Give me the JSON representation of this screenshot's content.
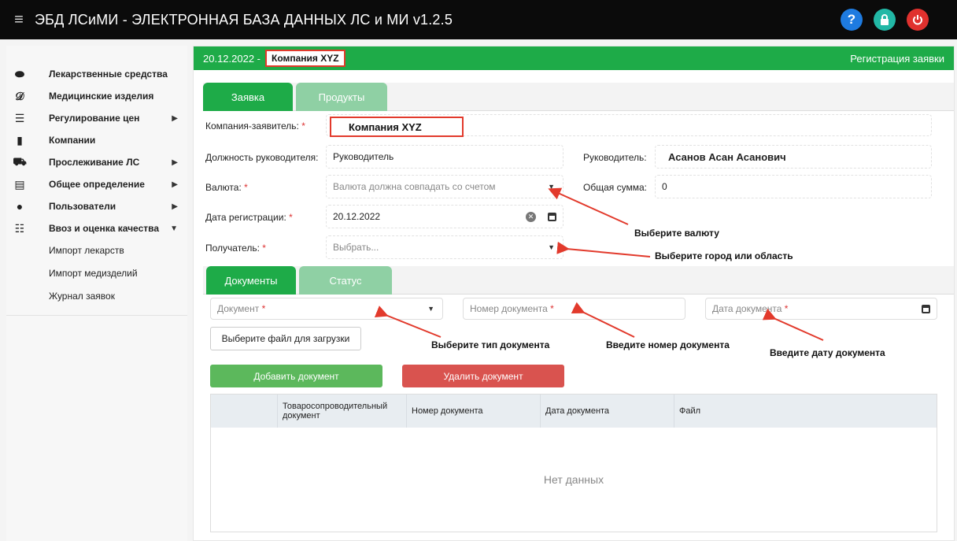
{
  "app": {
    "menu_icon": "hamburger-icon",
    "title": "ЭБД ЛСиМИ - ЭЛЕКТРОННАЯ БАЗА ДАННЫХ ЛС и МИ v1.2.5",
    "icons": [
      "help-icon",
      "lock-icon",
      "power-icon"
    ]
  },
  "sidebar": {
    "items": [
      {
        "label": "Лекарственные средства",
        "icon": "pills-icon",
        "has_arrow": false
      },
      {
        "label": "Медицинские изделия",
        "icon": "hearing-icon",
        "has_arrow": false
      },
      {
        "label": "Регулирование цен",
        "icon": "list-check-icon",
        "has_arrow": true
      },
      {
        "label": "Компании",
        "icon": "briefcase-icon",
        "has_arrow": false
      },
      {
        "label": "Прослеживание ЛС",
        "icon": "ambulance-icon",
        "has_arrow": true
      },
      {
        "label": "Общее определение",
        "icon": "list-box-icon",
        "has_arrow": true
      },
      {
        "label": "Пользователи",
        "icon": "user-icon",
        "has_arrow": true
      },
      {
        "label": "Ввоз и оценка качества",
        "icon": "indent-icon",
        "has_arrow": true
      }
    ],
    "subitems": [
      "Импорт лекарств",
      "Импорт медизделий",
      "Журнал заявок"
    ]
  },
  "header": {
    "date": "20.12.2022 -",
    "company": "Компания XYZ",
    "right": "Регистрация заявки"
  },
  "tabs1": [
    "Заявка",
    "Продукты"
  ],
  "form": {
    "company_label": "Компания-заявитель:",
    "company_value": "Компания XYZ",
    "position_label": "Должность руководителя:",
    "position_value": "Руководитель",
    "head_label": "Руководитель:",
    "head_value": "Асанов Асан Асанович",
    "currency_label": "Валюта:",
    "currency_placeholder": "Валюта должна совпадать со счетом",
    "total_label": "Общая сумма:",
    "total_value": "0",
    "regdate_label": "Дата регистрации:",
    "regdate_value": "20.12.2022",
    "recipient_label": "Получатель:",
    "recipient_placeholder": "Выбрать...",
    "required_mark": "*"
  },
  "tabs2": [
    "Документы",
    "Статус"
  ],
  "docs": {
    "doc_type_placeholder": "Документ",
    "doc_number_placeholder": "Номер документа",
    "doc_date_placeholder": "Дата документа",
    "file_button": "Выберите файл для загрузки",
    "add_button": "Добавить документ",
    "delete_button": "Удалить документ",
    "columns": [
      "",
      "Товаросопроводительный документ",
      "Номер документа",
      "Дата документа",
      "Файл"
    ],
    "empty_text": "Нет данных"
  },
  "annotations": {
    "currency": "Выберите валюту",
    "recipient": "Выберите город или область",
    "doc_type": "Выберите тип документа",
    "doc_number": "Введите номер документа",
    "doc_date": "Введите дату документа"
  },
  "colors": {
    "green": "#1eab48",
    "red": "#e23a2c"
  }
}
